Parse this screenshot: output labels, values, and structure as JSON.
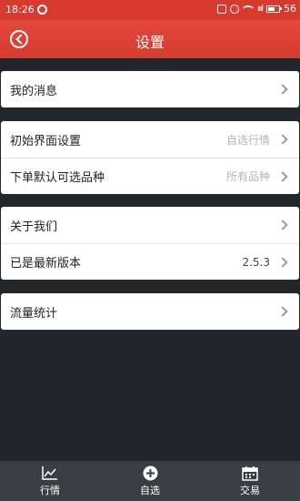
{
  "status_bar": {
    "time": "18:26",
    "battery_level": "56"
  },
  "header": {
    "title": "设置",
    "back_icon": "back-circle-icon"
  },
  "groups": [
    {
      "rows": [
        {
          "label": "我的消息",
          "value": ""
        }
      ]
    },
    {
      "rows": [
        {
          "label": "初始界面设置",
          "value": "自选行情"
        },
        {
          "label": "下单默认可选品种",
          "value": "所有品种"
        }
      ]
    },
    {
      "rows": [
        {
          "label": "关于我们",
          "value": ""
        },
        {
          "label": "已是最新版本",
          "value": "2.5.3"
        }
      ]
    },
    {
      "rows": [
        {
          "label": "流量统计",
          "value": ""
        }
      ]
    }
  ],
  "tabbar": {
    "tabs": [
      {
        "label": "行情",
        "icon": "chart-icon"
      },
      {
        "label": "自选",
        "icon": "add-circle-icon"
      },
      {
        "label": "交易",
        "icon": "calendar-icon"
      }
    ]
  },
  "colors": {
    "accent": "#d93a30",
    "background": "#23262b",
    "tabbar": "#3a3d42"
  }
}
